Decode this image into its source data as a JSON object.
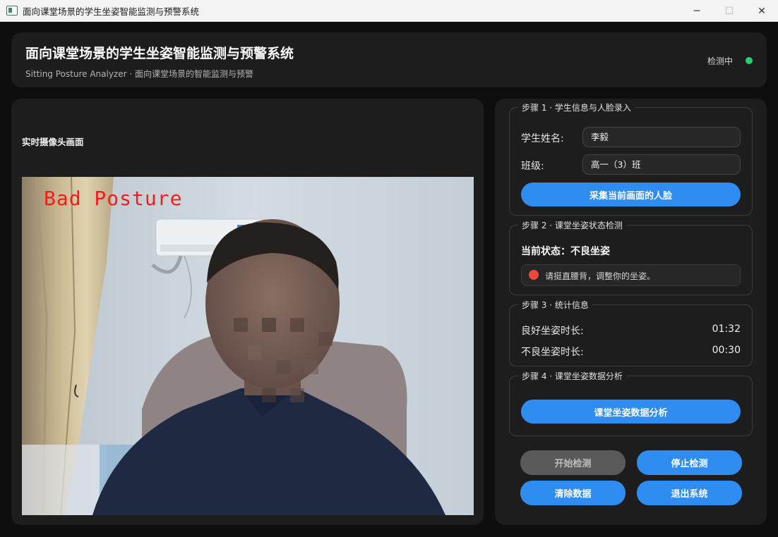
{
  "window": {
    "title": "面向课堂场景的学生坐姿智能监测与预警系统",
    "controls": {
      "minimize": "─",
      "maximize": "☐",
      "close": "✕"
    }
  },
  "header": {
    "title": "面向课堂场景的学生坐姿智能监测与预警系统",
    "subtitle": "Sitting Posture Analyzer · 面向课堂场景的智能监测与预警",
    "status_text": "检测中",
    "status_color": "#2ecc71"
  },
  "camera": {
    "label": "实时摄像头画面",
    "overlay_text": "Bad Posture",
    "overlay_color": "#ff1a1a"
  },
  "step1": {
    "title": "步骤 1 · 学生信息与人脸录入",
    "name_label": "学生姓名:",
    "name_value": "李毅",
    "class_label": "班级:",
    "class_value": "高一（3）班",
    "capture_button": "采集当前画面的人脸"
  },
  "step2": {
    "title": "步骤 2 · 课堂坐姿状态检测",
    "state_text": "当前状态：不良坐姿",
    "alert_text": "请挺直腰背，调整你的坐姿。",
    "alert_color": "#f0473a"
  },
  "step3": {
    "title": "步骤 3 · 统计信息",
    "good_label": "良好坐姿时长:",
    "good_value": "01:32",
    "bad_label": "不良坐姿时长:",
    "bad_value": "00:30"
  },
  "step4": {
    "title": "步骤 4 · 课堂坐姿数据分析",
    "analyze_button": "课堂坐姿数据分析"
  },
  "actions": {
    "start": "开始检测",
    "stop": "停止检测",
    "clear": "清除数据",
    "exit": "退出系统"
  },
  "colors": {
    "accent": "#2f8cf0",
    "card": "#1d1d1d",
    "background": "#0e0e0e"
  }
}
